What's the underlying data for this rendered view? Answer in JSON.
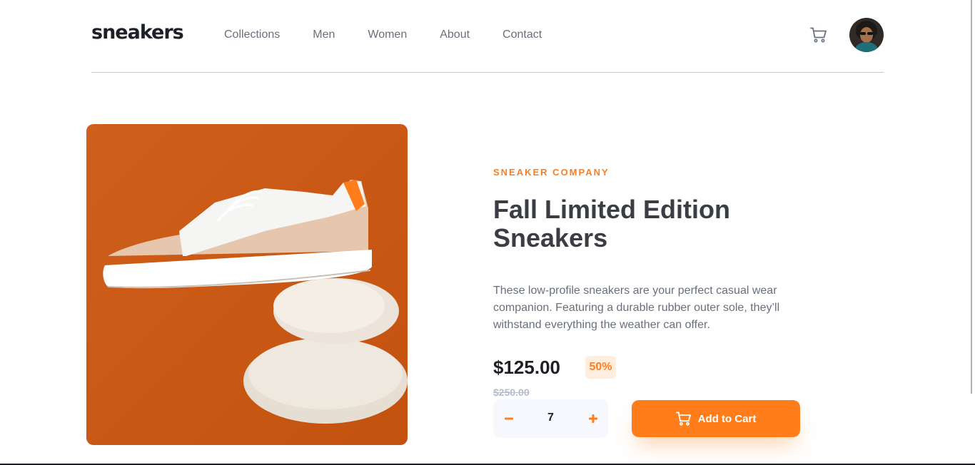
{
  "header": {
    "logo": "sneakers",
    "nav": [
      "Collections",
      "Men",
      "Women",
      "About",
      "Contact"
    ],
    "cart_icon": "cart-icon",
    "avatar_icon": "avatar"
  },
  "product": {
    "company": "SNEAKER COMPANY",
    "title_line1": "Fall Limited Edition",
    "title_line2": "Sneakers",
    "description": "These low-profile sneakers are your perfect casual wear companion. Featuring a durable rubber outer sole, they’ll withstand everything the weather can offer.",
    "price": "$125.00",
    "discount": "50%",
    "old_price": "$250.00",
    "quantity": "7",
    "add_to_cart": "Add to Cart"
  },
  "colors": {
    "accent": "#ff7e1b",
    "accent_pale": "#ffede0",
    "dark_text": "#1d2026",
    "grey_text": "#69707d"
  }
}
